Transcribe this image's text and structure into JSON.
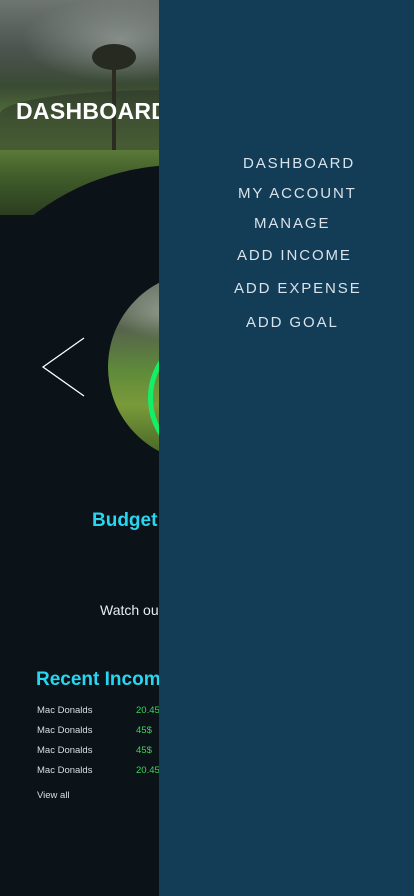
{
  "dashboard": {
    "title": "DASHBOARD",
    "budget_label": "Budget",
    "watch_text": "Watch ou",
    "recent_income": {
      "title": "Recent Incom",
      "items": [
        {
          "name": "Mac Donalds",
          "amount": "20.45"
        },
        {
          "name": "Mac Donalds",
          "amount": "45$"
        },
        {
          "name": "Mac Donalds",
          "amount": "45$"
        },
        {
          "name": "Mac Donalds",
          "amount": "20.45"
        }
      ],
      "view_all": "View all"
    },
    "budget_ring_color": "#12f06a",
    "accent_color": "#27d6f0"
  },
  "menu": {
    "background": "#133c57",
    "items": [
      {
        "label": "DASHBOARD"
      },
      {
        "label": "MY ACCOUNT"
      },
      {
        "label": "MANAGE"
      },
      {
        "label": "ADD INCOME"
      },
      {
        "label": "ADD EXPENSE"
      },
      {
        "label": "ADD GOAL"
      }
    ]
  }
}
